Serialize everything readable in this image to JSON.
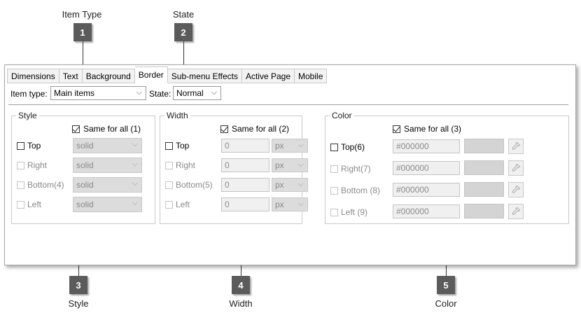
{
  "callouts": [
    {
      "number": "1",
      "title": "Item Type"
    },
    {
      "number": "2",
      "title": "State"
    },
    {
      "number": "3",
      "title": "Style"
    },
    {
      "number": "4",
      "title": "Width"
    },
    {
      "number": "5",
      "title": "Color"
    }
  ],
  "tabs": [
    "Dimensions",
    "Text",
    "Background",
    "Border",
    "Sub-menu Effects",
    "Active Page",
    "Mobile"
  ],
  "active_tab": "Border",
  "item_type": {
    "label": "Item type:",
    "value": "Main items"
  },
  "state": {
    "label": "State:",
    "value": "Normal"
  },
  "style_group": {
    "legend": "Style",
    "same_for_all": "Same for all (1)",
    "rows": [
      {
        "label": "Top",
        "value": "solid"
      },
      {
        "label": "Right",
        "value": "solid"
      },
      {
        "label": "Bottom(4)",
        "value": "solid"
      },
      {
        "label": "Left",
        "value": "solid"
      }
    ]
  },
  "width_group": {
    "legend": "Width",
    "same_for_all": "Same for all (2)",
    "rows": [
      {
        "label": "Top",
        "value": "0",
        "unit": "px"
      },
      {
        "label": "Right",
        "value": "0",
        "unit": "px"
      },
      {
        "label": "Bottom(5)",
        "value": "0",
        "unit": "px"
      },
      {
        "label": "Left",
        "value": "0",
        "unit": "px"
      }
    ]
  },
  "color_group": {
    "legend": "Color",
    "same_for_all": "Same for all (3)",
    "rows": [
      {
        "label": "Top(6)",
        "value": "#000000"
      },
      {
        "label": "Right(7)",
        "value": "#000000"
      },
      {
        "label": "Bottom (8)",
        "value": "#000000"
      },
      {
        "label": "Left (9)",
        "value": "#000000"
      }
    ]
  },
  "colors": {
    "badge": "#5b5b5b",
    "disabled_fill": "#dcdcdc",
    "swatch": "#d4d4d4"
  },
  "icons": {
    "dropdown": "chevron-down-icon",
    "picker": "eyedropper-icon",
    "check": "checkmark-icon"
  }
}
